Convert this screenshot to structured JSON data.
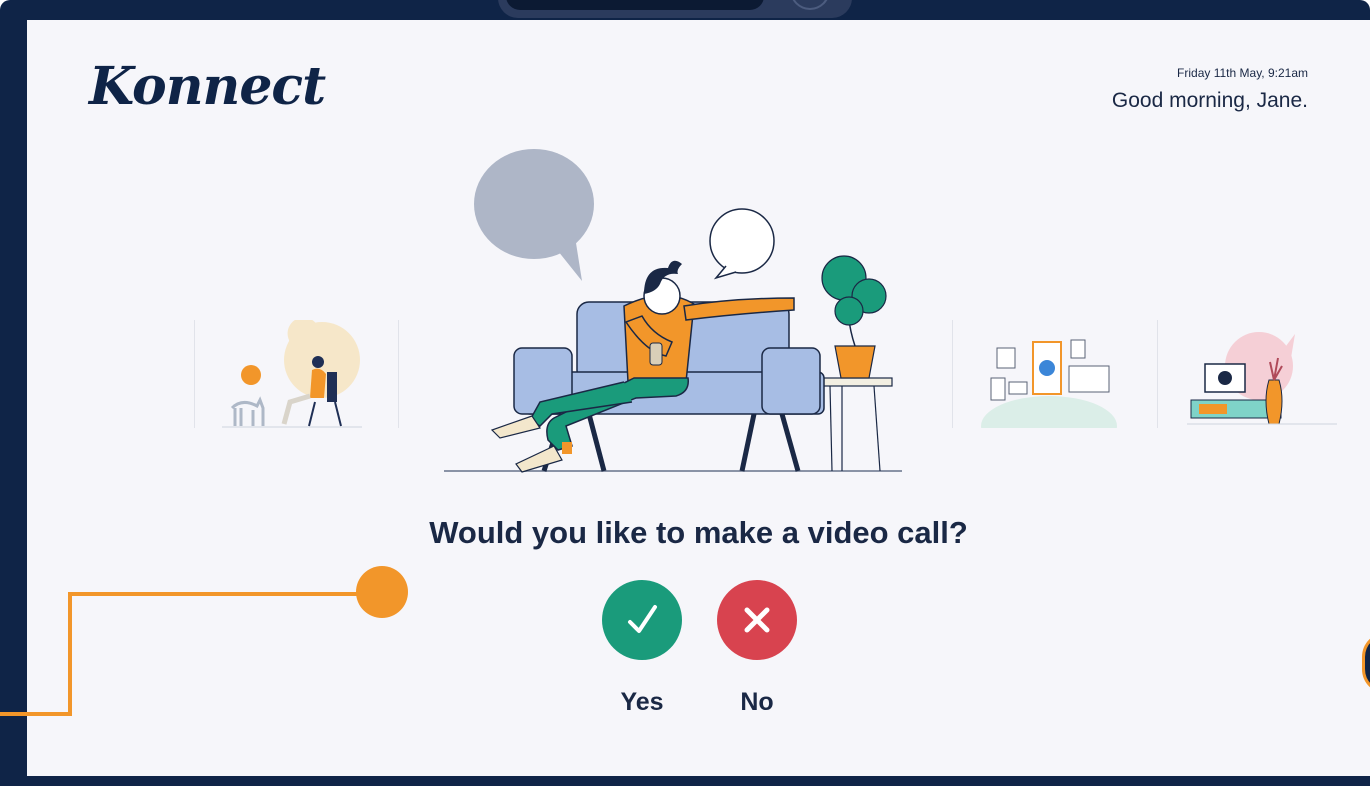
{
  "app": {
    "logo_text": "Konnect"
  },
  "header": {
    "datetime": "Friday 11th May, 9:21am",
    "greeting": "Good morning, Jane."
  },
  "main": {
    "prompt": "Would you like to make a video call?",
    "actions": [
      {
        "label": "Yes",
        "icon": "checkmark-icon",
        "color": "#1a9b7b"
      },
      {
        "label": "No",
        "icon": "close-icon",
        "color": "#d8434f"
      }
    ],
    "carousel": [
      {
        "name": "person-with-dog-illustration"
      },
      {
        "name": "woman-on-sofa-illustration"
      },
      {
        "name": "photo-wall-illustration"
      },
      {
        "name": "tv-video-call-illustration"
      }
    ]
  },
  "colors": {
    "bezel": "#0f2447",
    "screen": "#f6f6fa",
    "accent": "#f2962a"
  }
}
